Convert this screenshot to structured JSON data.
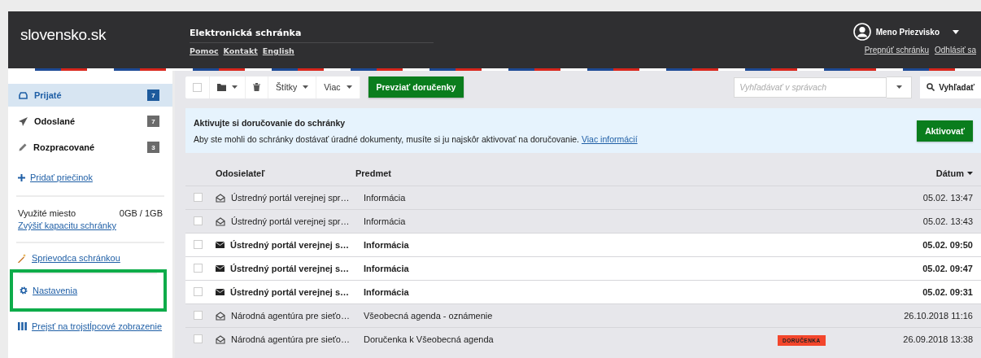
{
  "header": {
    "logo": "slovensko.sk",
    "title": "Elektronická schránka",
    "links": [
      "Pomoc",
      "Kontakt",
      "English"
    ],
    "user": "Meno Priezvisko",
    "user_links": [
      "Prepnúť schránku",
      "Odhlásiť sa"
    ]
  },
  "sidebar": {
    "folders": [
      {
        "kind": "inbox",
        "label": "Prijaté",
        "count": "7",
        "selected": true
      },
      {
        "kind": "sent",
        "label": "Odoslané",
        "count": "7",
        "selected": false
      },
      {
        "kind": "draft",
        "label": "Rozpracované",
        "count": "3",
        "selected": false
      }
    ],
    "add_folder": "Pridať priečinok",
    "storage": {
      "label": "Využité miesto",
      "value": "0GB / 1GB",
      "link": "Zvýšiť kapacitu schránky"
    },
    "links": [
      {
        "kind": "wizard",
        "label": "Sprievodca schránkou",
        "highlighted": false
      },
      {
        "kind": "settings",
        "label": "Nastavenia",
        "highlighted": true
      },
      {
        "kind": "columns",
        "label": "Prejsť na trojstĺpcové zobrazenie",
        "highlighted": false
      }
    ]
  },
  "toolbar": {
    "select_all_checked": false,
    "buttons": [
      "Štítky",
      "Viac"
    ],
    "primary": "Prevziať doručenky",
    "search": {
      "placeholder": "Vyhľadávať v správach"
    },
    "search_button": "Vyhľadať"
  },
  "banner": {
    "title": "Aktivujte si doručovanie do schránky",
    "text": "Aby ste mohli do schránky dostávať úradné dokumenty, musíte si ju najskôr aktivovať na doručovanie.",
    "link": "Viac informácií",
    "button": "Aktivovať"
  },
  "table": {
    "columns": [
      "Odosielateľ",
      "Predmet",
      "Dátum"
    ],
    "rows": [
      {
        "checked": false,
        "unread": false,
        "sender": "Ústredný portál verejnej spr…",
        "subject": "Informácia",
        "date": "05.02. 13:47"
      },
      {
        "checked": false,
        "unread": false,
        "sender": "Ústredný portál verejnej spr…",
        "subject": "Informácia",
        "date": "05.02. 13:43"
      },
      {
        "checked": false,
        "unread": true,
        "sender": "Ústredný portál verejnej s…",
        "subject": "Informácia",
        "date": "05.02. 09:50"
      },
      {
        "checked": false,
        "unread": true,
        "sender": "Ústredný portál verejnej s…",
        "subject": "Informácia",
        "date": "05.02. 09:47"
      },
      {
        "checked": false,
        "unread": true,
        "sender": "Ústredný portál verejnej s…",
        "subject": "Informácia",
        "date": "05.02. 09:31"
      },
      {
        "checked": false,
        "unread": false,
        "sender": "Národná agentúra pre sieťo…",
        "subject": "Všeobecná agenda - oznámenie",
        "date": "26.10.2018 11:16"
      },
      {
        "checked": false,
        "unread": false,
        "sender": "Národná agentúra pre sieťo…",
        "subject": "Doručenka k Všeobecná agenda",
        "tag": "DORUČENKA",
        "date": "26.09.2018 13:38"
      }
    ]
  }
}
